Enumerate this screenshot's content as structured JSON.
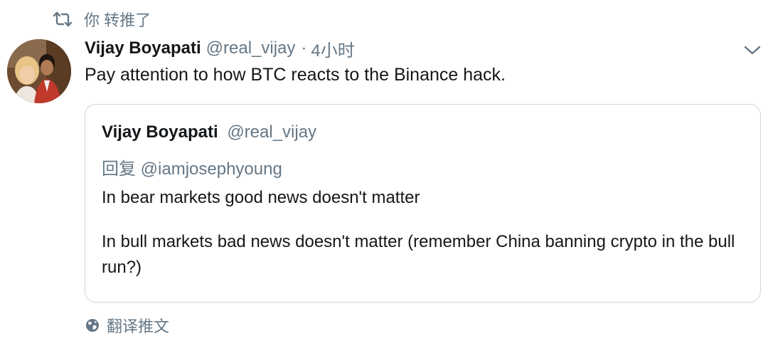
{
  "retweet": {
    "icon": "retweet-icon",
    "label": "你 转推了"
  },
  "tweet": {
    "author_name": "Vijay Boyapati",
    "author_handle": "@real_vijay",
    "separator": "·",
    "timestamp": "4小时",
    "text": "Pay attention to how BTC reacts to the Binance hack.",
    "menu_icon": "chevron-down-icon"
  },
  "quoted_tweet": {
    "author_name": "Vijay Boyapati",
    "author_handle": "@real_vijay",
    "reply_prefix": "回复",
    "reply_mention": "@iamjosephyoung",
    "paragraph_1": "In bear markets good news doesn't matter",
    "paragraph_2": "In bull markets bad news doesn't matter (remember China banning crypto in the bull run?)"
  },
  "translate": {
    "icon": "globe-icon",
    "label": "翻译推文"
  },
  "colors": {
    "text_primary": "#14171a",
    "text_secondary": "#657786",
    "border": "#ccd6dd"
  }
}
